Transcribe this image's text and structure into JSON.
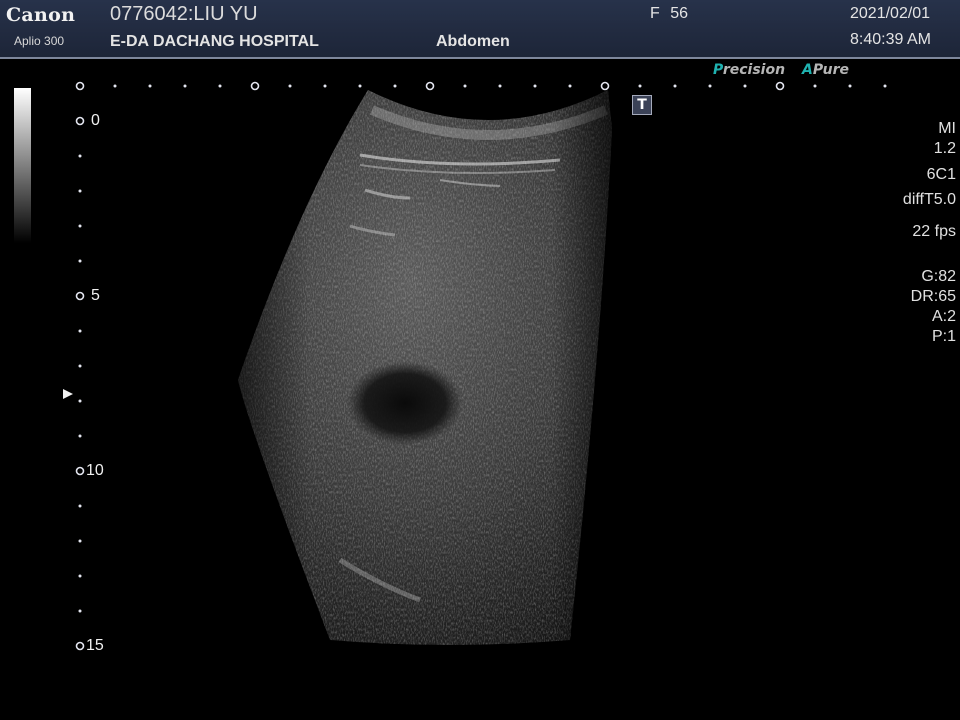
{
  "header": {
    "brand": "Canon",
    "model": "Aplio 300",
    "patient": "0776042:LIU YU",
    "hospital": "E-DA DACHANG HOSPITAL",
    "exam": "Abdomen",
    "sex_age": "F 56",
    "date": "2021/02/01",
    "time": "8:40:39 AM"
  },
  "brandmarks": {
    "precision_initial": "P",
    "precision_rest": "recision",
    "apure_initial": "A",
    "apure_rest": "Pure"
  },
  "depth_scale": {
    "labels": [
      "0",
      "5",
      "10",
      "15"
    ],
    "focus_depth": 7.5
  },
  "t_icon": "T",
  "params": {
    "mi_label": "MI",
    "mi_value": "1.2",
    "probe": "6C1",
    "harmonic": "diffT5.0",
    "frame_rate": "22 fps",
    "gain": "G:82",
    "dynamic_range": "DR:65",
    "a": "A:2",
    "p": "P:1"
  },
  "colors": {
    "header_bg": "#1d2538",
    "accent_teal": "#1fb2b0",
    "text": "#e8e8e8",
    "screen_bg": "#000000"
  }
}
